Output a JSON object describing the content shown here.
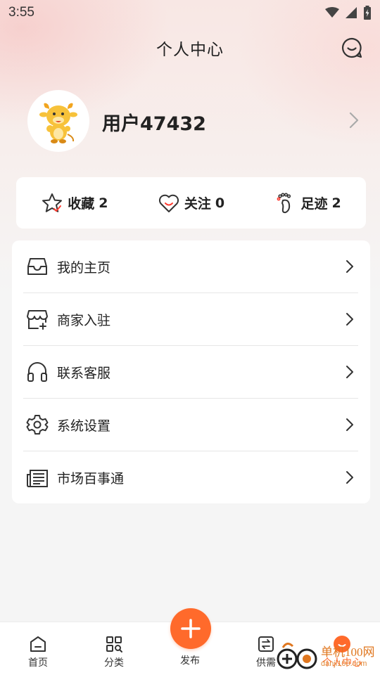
{
  "status_bar": {
    "time": "3:55"
  },
  "header": {
    "title": "个人中心"
  },
  "profile": {
    "username": "用户47432"
  },
  "stats": [
    {
      "label": "收藏",
      "count": "2",
      "icon": "star-icon"
    },
    {
      "label": "关注",
      "count": "0",
      "icon": "heart-icon"
    },
    {
      "label": "足迹",
      "count": "2",
      "icon": "footprint-icon"
    }
  ],
  "menu": [
    {
      "label": "我的主页",
      "icon": "inbox-icon"
    },
    {
      "label": "商家入驻",
      "icon": "store-icon"
    },
    {
      "label": "联系客服",
      "icon": "headset-icon"
    },
    {
      "label": "系统设置",
      "icon": "gear-icon"
    },
    {
      "label": "市场百事通",
      "icon": "news-icon"
    }
  ],
  "tabbar": {
    "home": "首页",
    "category": "分类",
    "publish": "发布",
    "supply": "供需",
    "profile": "个人中心"
  },
  "watermark": {
    "brand": "单机100网",
    "url": "danji100.com"
  },
  "colors": {
    "accent": "#ff6a2b",
    "background": "#f5f5f5",
    "card": "#ffffff"
  }
}
